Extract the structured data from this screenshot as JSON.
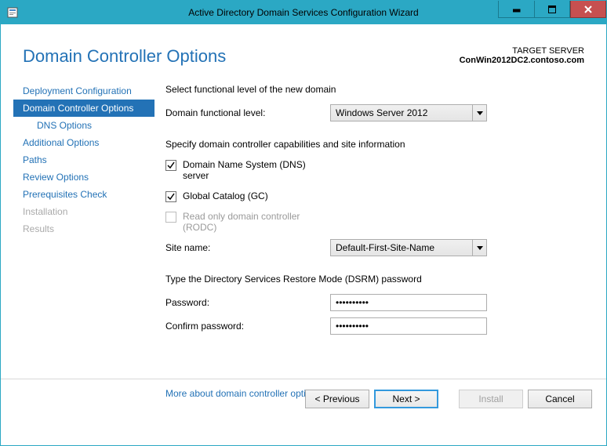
{
  "window": {
    "title": "Active Directory Domain Services Configuration Wizard"
  },
  "header": {
    "pageTitle": "Domain Controller Options",
    "targetLabel": "TARGET SERVER",
    "targetServer": "ConWin2012DC2.contoso.com"
  },
  "sidebar": {
    "items": [
      {
        "label": "Deployment Configuration",
        "active": false,
        "disabled": false
      },
      {
        "label": "Domain Controller Options",
        "active": true,
        "disabled": false
      },
      {
        "label": "DNS Options",
        "active": false,
        "disabled": false,
        "sub": true
      },
      {
        "label": "Additional Options",
        "active": false,
        "disabled": false
      },
      {
        "label": "Paths",
        "active": false,
        "disabled": false
      },
      {
        "label": "Review Options",
        "active": false,
        "disabled": false
      },
      {
        "label": "Prerequisites Check",
        "active": false,
        "disabled": false
      },
      {
        "label": "Installation",
        "active": false,
        "disabled": true
      },
      {
        "label": "Results",
        "active": false,
        "disabled": true
      }
    ]
  },
  "content": {
    "section1": "Select functional level of the new domain",
    "domainLevelLabel": "Domain functional level:",
    "domainLevelValue": "Windows Server 2012",
    "section2": "Specify domain controller capabilities and site information",
    "dnsLabel": "Domain Name System (DNS) server",
    "gcLabel": "Global Catalog (GC)",
    "rodcLabel": "Read only domain controller (RODC)",
    "siteNameLabel": "Site name:",
    "siteNameValue": "Default-First-Site-Name",
    "section3": "Type the Directory Services Restore Mode (DSRM) password",
    "passwordLabel": "Password:",
    "passwordValue": "••••••••••",
    "confirmLabel": "Confirm password:",
    "confirmValue": "••••••••••",
    "moreLink": "More about domain controller options"
  },
  "footer": {
    "previous": "< Previous",
    "next": "Next >",
    "install": "Install",
    "cancel": "Cancel"
  }
}
